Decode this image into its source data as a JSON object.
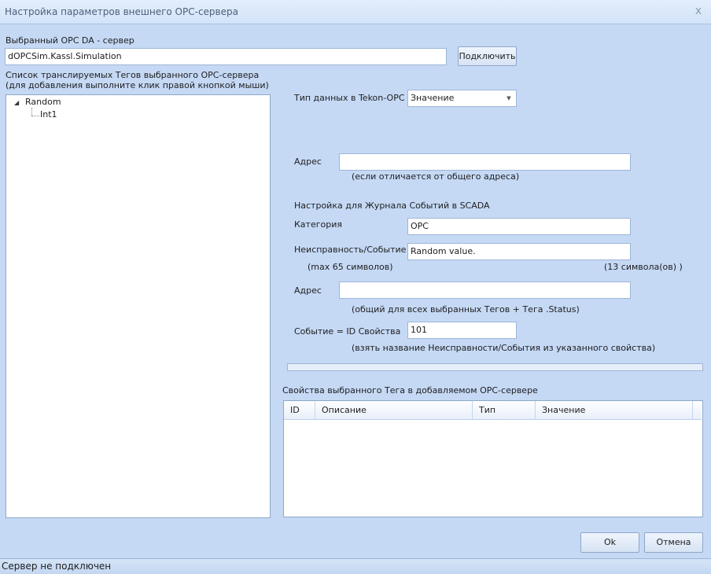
{
  "window": {
    "title": "Настройка параметров внешнего OPC-сервера",
    "close_glyph": "x"
  },
  "server": {
    "label": "Выбранный OPC DA - сервер",
    "value": "dOPCSim.Kassl.Simulation",
    "connect_label": "Подключить"
  },
  "tags": {
    "label_line1": "Список транслируемых Тегов выбранного OPC-сервера",
    "label_line2": "(для добавления выполните клик правой кнопкой мыши)",
    "tree": {
      "root_label": "Random",
      "child_label": "Int1",
      "expanded": true
    }
  },
  "datatype": {
    "label": "Тип данных в Tekon-OPC",
    "value": "Значение"
  },
  "address1": {
    "label": "Адрес",
    "value": "",
    "hint": "(если отличается от общего адреса)"
  },
  "scada": {
    "section_label": "Настройка для Журнала Событий в SCADA",
    "category_label": "Категория",
    "category_value": "OPC",
    "fault_label": "Неисправность/Событие",
    "fault_value": "Random value.",
    "max_hint": "(max 65 символов)",
    "count_hint": "(13 символа(ов) )",
    "address_label": "Адрес",
    "address_value": "",
    "address_hint": "(общий для всех выбранных Тегов + Тега .Status)",
    "event_label": "Событие  = ID Свойства",
    "event_value": "101",
    "event_hint": "(взять название Неисправности/События из указанного свойства)"
  },
  "properties": {
    "label": "Свойства выбранного Тега в добавляемом  OPC-сервере",
    "columns": [
      "ID",
      "Описание",
      "Тип",
      "Значение"
    ],
    "rows": []
  },
  "buttons": {
    "ok": "Ok",
    "cancel": "Отмена"
  },
  "status": {
    "text": "Сервер не подключен"
  }
}
